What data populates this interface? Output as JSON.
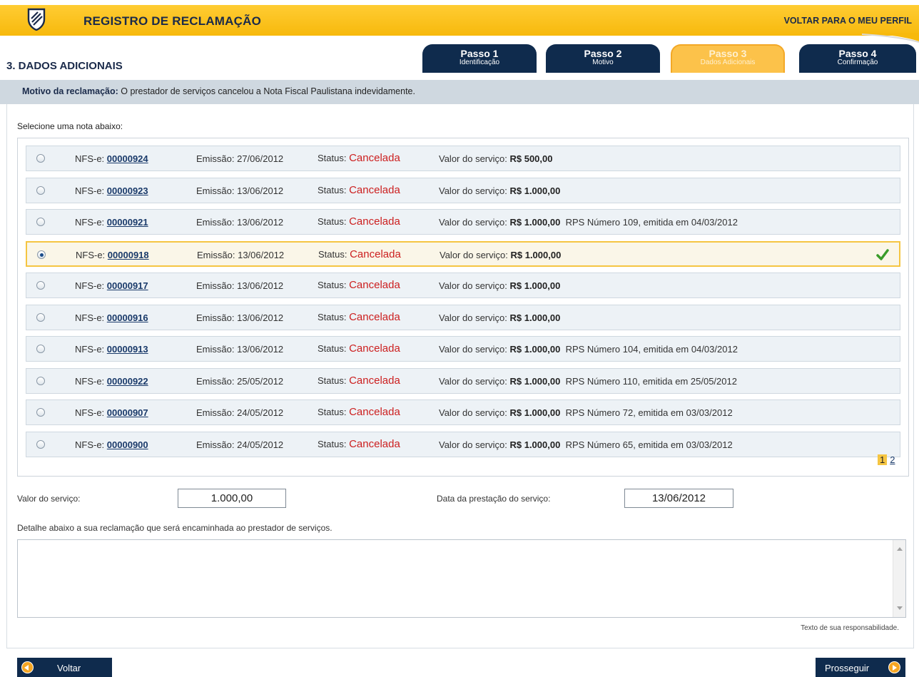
{
  "header": {
    "title": "REGISTRO DE RECLAMAÇÃO",
    "back_to_profile": "VOLTAR PARA O MEU PERFIL"
  },
  "section_title": "3. DADOS ADICIONAIS",
  "steps": [
    {
      "title": "Passo 1",
      "subtitle": "Identificação"
    },
    {
      "title": "Passo 2",
      "subtitle": "Motivo"
    },
    {
      "title": "Passo 3",
      "subtitle": "Dados Adicionais",
      "active": true
    },
    {
      "title": "Passo 4",
      "subtitle": "Confirmação"
    }
  ],
  "motivo": {
    "label": "Motivo da reclamação:",
    "text": "O prestador de serviços cancelou a Nota Fiscal Paulistana indevidamente."
  },
  "select_label": "Selecione uma nota abaixo:",
  "labels": {
    "nfs": "NFS-e:",
    "emissao": "Emissão:",
    "status": "Status:",
    "valor": "Valor do serviço:"
  },
  "notes": [
    {
      "number": "00000924",
      "date": "27/06/2012",
      "status": "Cancelada",
      "value": "R$ 500,00",
      "rps": "",
      "selected": false
    },
    {
      "number": "00000923",
      "date": "13/06/2012",
      "status": "Cancelada",
      "value": "R$ 1.000,00",
      "rps": "",
      "selected": false
    },
    {
      "number": "00000921",
      "date": "13/06/2012",
      "status": "Cancelada",
      "value": "R$ 1.000,00",
      "rps": "RPS Número 109, emitida em 04/03/2012",
      "selected": false
    },
    {
      "number": "00000918",
      "date": "13/06/2012",
      "status": "Cancelada",
      "value": "R$ 1.000,00",
      "rps": "",
      "selected": true
    },
    {
      "number": "00000917",
      "date": "13/06/2012",
      "status": "Cancelada",
      "value": "R$ 1.000,00",
      "rps": "",
      "selected": false
    },
    {
      "number": "00000916",
      "date": "13/06/2012",
      "status": "Cancelada",
      "value": "R$ 1.000,00",
      "rps": "",
      "selected": false
    },
    {
      "number": "00000913",
      "date": "13/06/2012",
      "status": "Cancelada",
      "value": "R$ 1.000,00",
      "rps": "RPS Número 104, emitida em 04/03/2012",
      "selected": false
    },
    {
      "number": "00000922",
      "date": "25/05/2012",
      "status": "Cancelada",
      "value": "R$ 1.000,00",
      "rps": "RPS Número 110, emitida em 25/05/2012",
      "selected": false
    },
    {
      "number": "00000907",
      "date": "24/05/2012",
      "status": "Cancelada",
      "value": "R$ 1.000,00",
      "rps": "RPS Número 72, emitida em 03/03/2012",
      "selected": false
    },
    {
      "number": "00000900",
      "date": "24/05/2012",
      "status": "Cancelada",
      "value": "R$ 1.000,00",
      "rps": "RPS Número 65, emitida em 03/03/2012",
      "selected": false
    }
  ],
  "pagination": {
    "current": "1",
    "pages": [
      "2"
    ]
  },
  "form": {
    "valor_label": "Valor do serviço:",
    "valor_value": "1.000,00",
    "data_label": "Data da prestação do serviço:",
    "data_value": "13/06/2012",
    "detail_label": "Detalhe abaixo a sua reclamação que será encaminhada ao prestador de serviços.",
    "detail_value": "",
    "hint": "Texto de sua responsabilidade."
  },
  "buttons": {
    "back": "Voltar",
    "next": "Prosseguir"
  },
  "colors": {
    "brand_yellow": "#f7b90c",
    "navy": "#0f2b4d",
    "status_red": "#cc1f1f",
    "check_green": "#3a9c2a"
  }
}
